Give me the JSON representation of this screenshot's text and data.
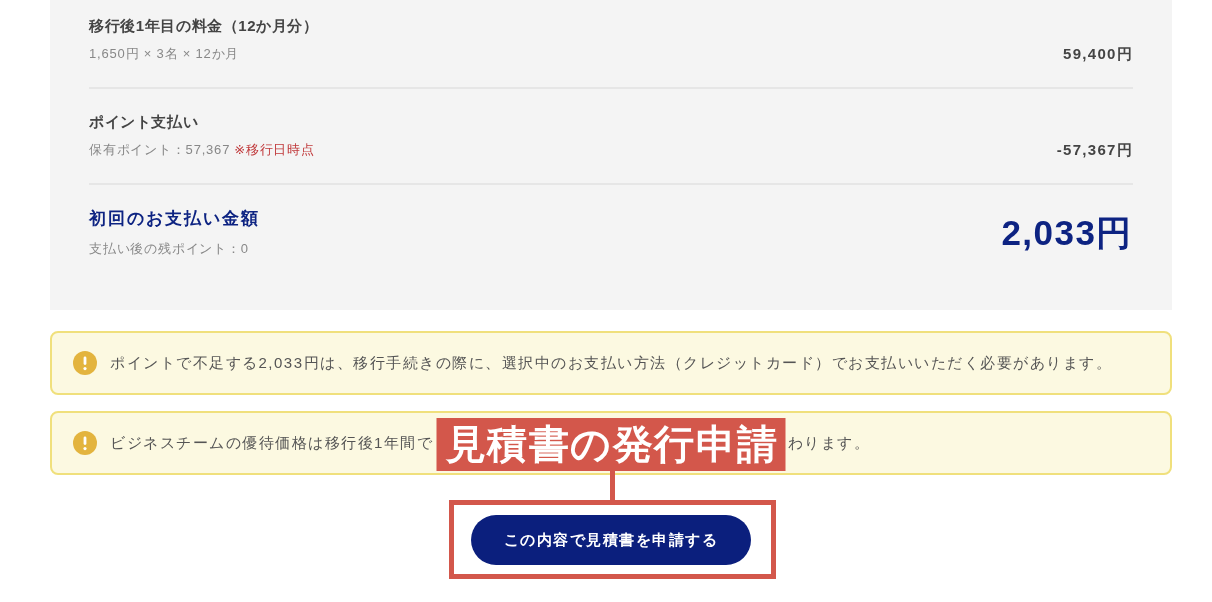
{
  "breakdown": {
    "rows": [
      {
        "kind": "line",
        "title": "移行後1年目の料金（12か月分）",
        "detail": "1,650円 × 3名 × 12か月",
        "amount": "59,400円"
      },
      {
        "kind": "line",
        "title": "ポイント支払い",
        "detail": "保有ポイント：57,367",
        "note": "※移行日時点",
        "amount": "-57,367円"
      },
      {
        "kind": "total",
        "title": "初回のお支払い金額",
        "detail": "支払い後の残ポイント：0",
        "amount": "2,033円"
      }
    ]
  },
  "notices": [
    {
      "text_parts": [
        "ポイントで不足する2,033円は、移行手続きの際に、選択中のお支払い方法（クレジットカード）でお支払いいただく必要があります。"
      ]
    },
    {
      "text_parts": [
        "ビジネスチームの優待価格は移行後1年間で",
        "わります。"
      ]
    }
  ],
  "submit_button": {
    "label": "この内容で見積書を申請する"
  },
  "annotation": {
    "label": "見積書の発行申請"
  }
}
